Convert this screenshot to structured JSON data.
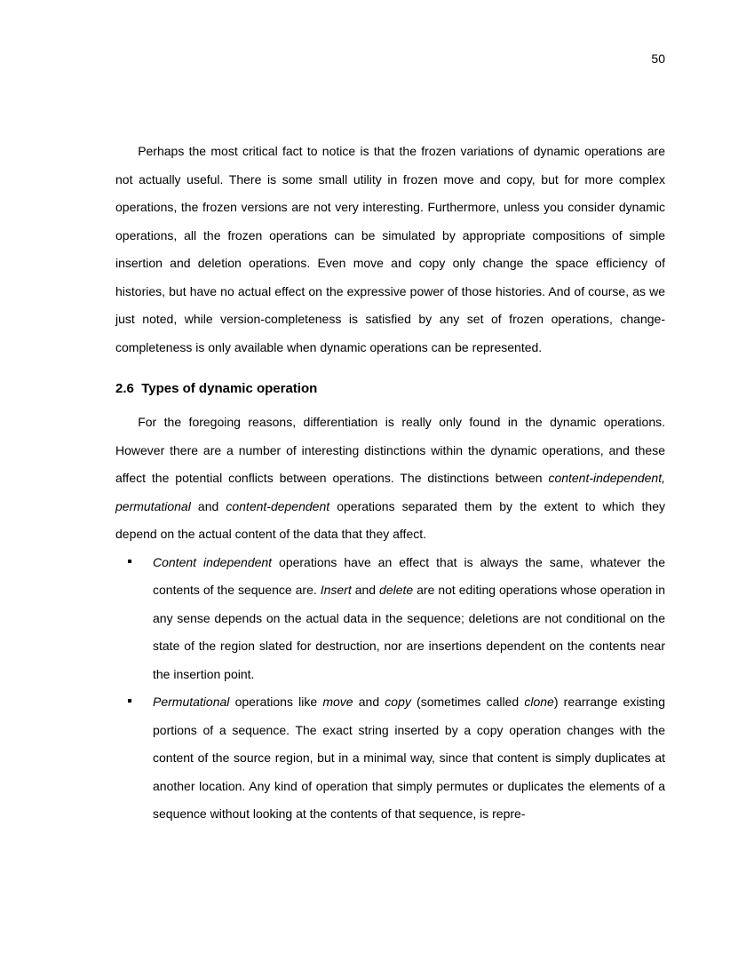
{
  "pageNumber": "50",
  "para1": "Perhaps the most critical fact to notice is that the frozen variations of dynamic operations are not actually useful. There is some small utility in frozen move and copy, but for more complex operations, the frozen versions are not very interesting. Furthermore, unless you consider dynamic operations, all the frozen operations can be simulated by appropriate compositions of simple insertion and deletion operations. Even move and copy only change the space efficiency of histories, but have no actual effect on the expressive power of those histories. And of course, as we just noted, while version-completeness is satisfied by any set of frozen operations, change-completeness is only available when dynamic operations can be represented.",
  "sectionNumber": "2.6",
  "sectionTitle": "Types of dynamic operation",
  "para2_a": "For the foregoing reasons, differentiation is really only found in the dynamic operations. However there are a number of interesting distinctions within the dynamic operations, and these affect the potential conflicts between operations. The distinctions between ",
  "para2_t1": "content-independent, permutational",
  "para2_b": " and ",
  "para2_t2": "content-dependent",
  "para2_c": " operations separated them by the extent to which they depend on the actual content of the data that they affect.",
  "bullet1_t1": "Content independent",
  "bullet1_a": " operations have an effect that is always the same, whatever the contents of the sequence are. ",
  "bullet1_t2": "Insert",
  "bullet1_b": " and ",
  "bullet1_t3": "delete",
  "bullet1_c": " are not editing operations whose operation in any sense depends on the actual data in the sequence; deletions are not conditional on the state of the region slated for destruction, nor are insertions dependent on the contents near the insertion point.",
  "bullet2_t1": "Permutational",
  "bullet2_a": " operations like ",
  "bullet2_t2": "move",
  "bullet2_b": " and ",
  "bullet2_t3": "copy",
  "bullet2_c": " (sometimes called ",
  "bullet2_t4": "clone",
  "bullet2_d": ") rearrange existing portions of a sequence. The exact string inserted by a copy operation changes with the content of the source region, but in a minimal way, since that content is simply duplicates at another location. Any kind of operation that simply permutes or duplicates the elements of a sequence without looking at the contents of that sequence, is repre-"
}
